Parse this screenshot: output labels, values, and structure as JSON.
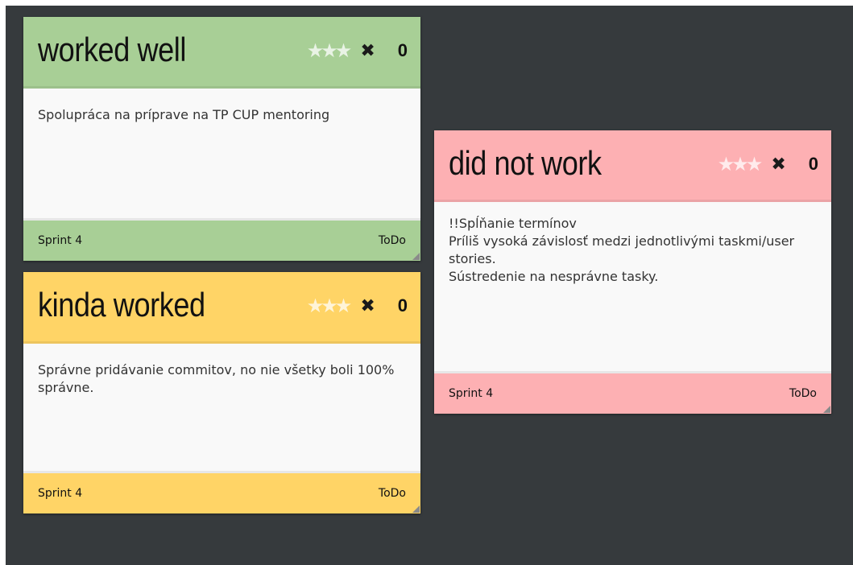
{
  "colors": {
    "board_background": "#363a3d",
    "worked_well": "#a8cf96",
    "kinda_worked": "#ffd466",
    "did_not_work": "#fdb0b3",
    "card_body": "#f9f9f9",
    "star_inactive": "#ffffffbf"
  },
  "cards": [
    {
      "title": "worked well",
      "stars": 3,
      "delete_icon": "close-icon",
      "votes": "0",
      "body": "Spolupráca na príprave na TP CUP mentoring",
      "sprint": "Sprint 4",
      "status": "ToDo"
    },
    {
      "title": "kinda worked",
      "stars": 3,
      "delete_icon": "close-icon",
      "votes": "0",
      "body": "Správne pridávanie commitov, no nie všetky boli 100% správne.",
      "sprint": "Sprint 4",
      "status": "ToDo"
    },
    {
      "title": "did not work",
      "stars": 3,
      "delete_icon": "close-icon",
      "votes": "0",
      "body": "!!Spĺňanie termínov\nPríliš vysoká závislosť medzi jednotlivými taskmi/user stories.\nSústredenie na nesprávne tasky.",
      "sprint": "Sprint 4",
      "status": "ToDo"
    }
  ]
}
